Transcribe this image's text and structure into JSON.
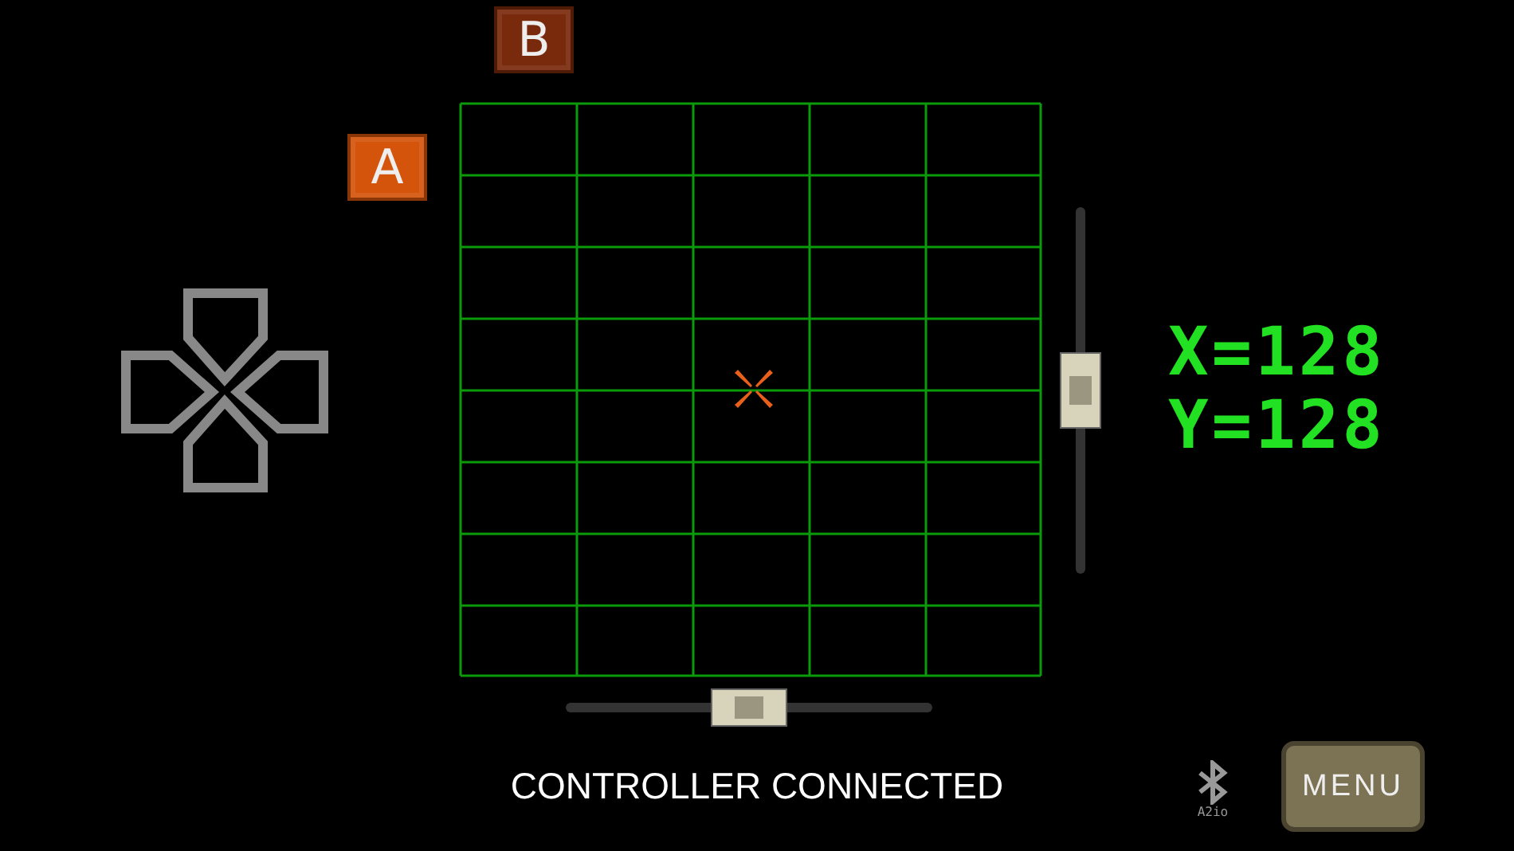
{
  "buttons": [
    {
      "label": "B",
      "color": "#7a2a0c"
    },
    {
      "label": "A",
      "color": "#d4540c"
    }
  ],
  "readout": [
    "X=128",
    "Y=128"
  ],
  "sliders": [
    {
      "kind": "vertical",
      "level": 0.5
    },
    {
      "kind": "horizontal",
      "level": 0.5
    }
  ],
  "status": "CONTROLLER CONNECTED",
  "bluetooth_label": "A2io",
  "menu_button": "MENU"
}
